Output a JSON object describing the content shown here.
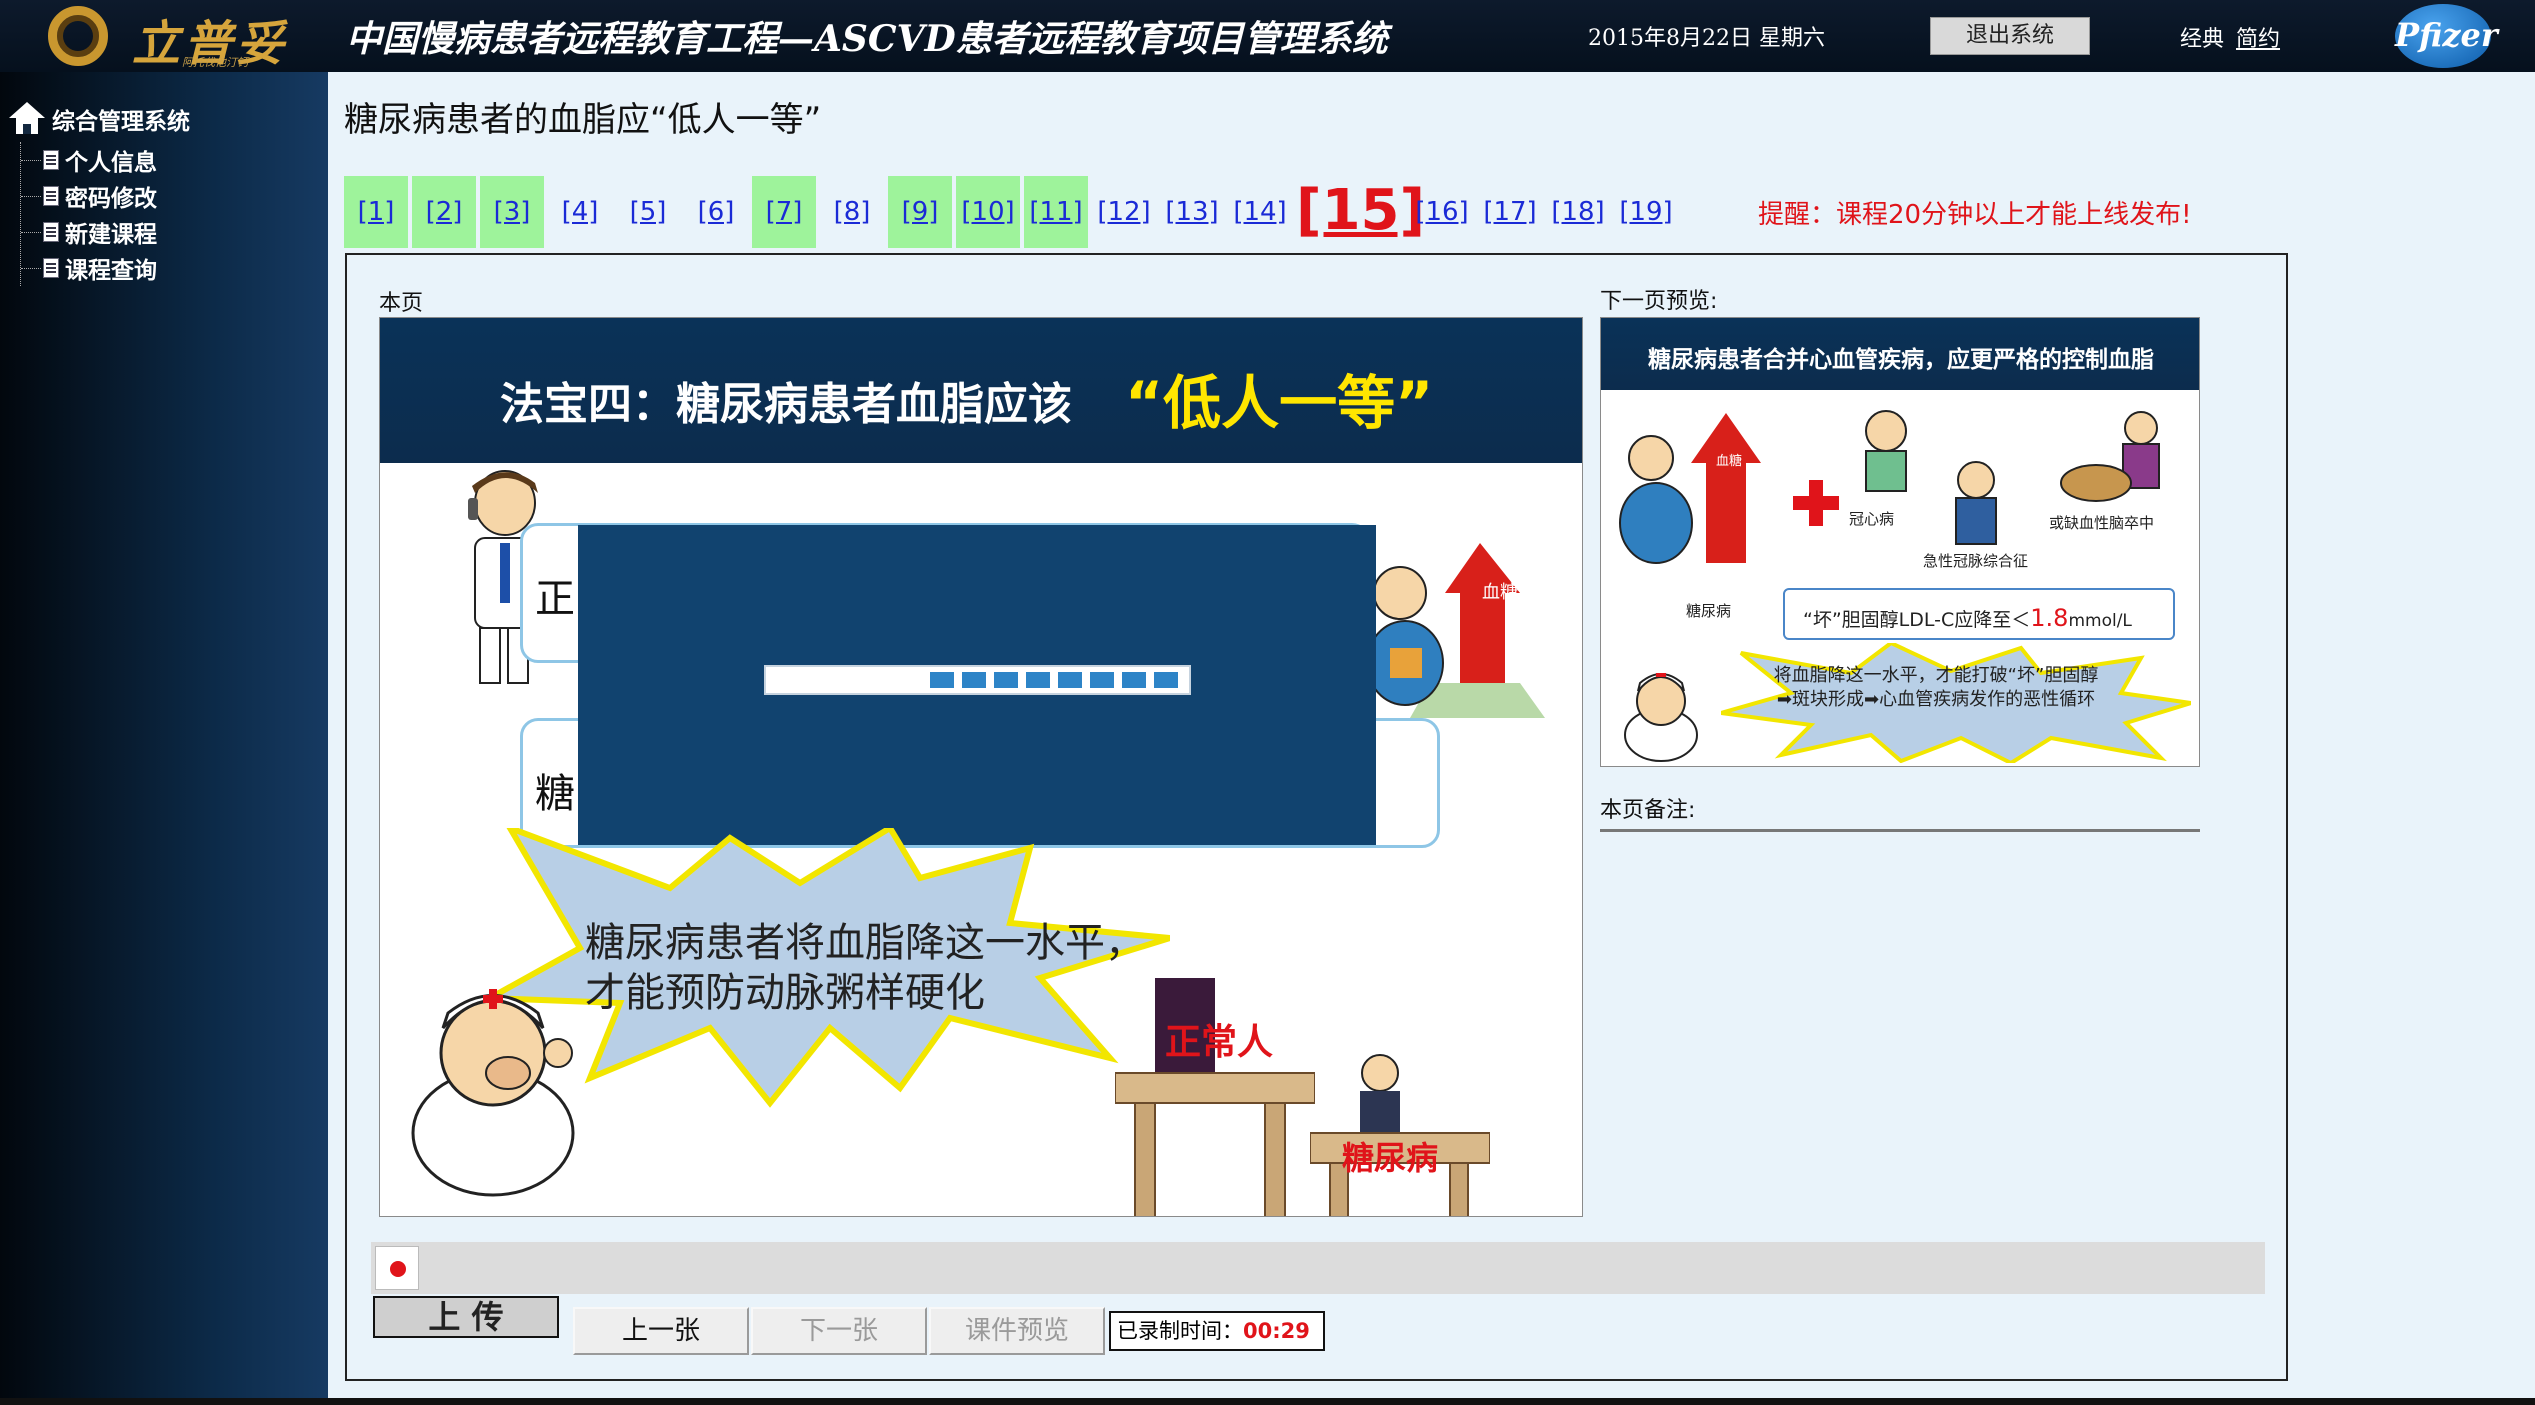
{
  "header": {
    "logo_text": "立普妥",
    "logo_tagline": "阿托伐他汀钙",
    "title": "中国慢病患者远程教育工程—ASCVD患者远程教育项目管理系统",
    "date": "2015年8月22日  星期六",
    "logout_label": "退出系统",
    "mode_classic": "经典",
    "mode_simple": "简约",
    "partner_logo": "Pfizer"
  },
  "sidebar": {
    "root_label": "综合管理系统",
    "items": [
      {
        "label": "个人信息"
      },
      {
        "label": "密码修改"
      },
      {
        "label": "新建课程"
      },
      {
        "label": "课程查询"
      }
    ]
  },
  "main": {
    "heading": "糖尿病患者的血脂应“低人一等”",
    "pager": {
      "pages": [
        "[1]",
        "[2]",
        "[3]",
        "[4]",
        "[5]",
        "[6]",
        "[7]",
        "[8]",
        "[9]",
        "[10]",
        "[11]",
        "[12]",
        "[13]",
        "[14]",
        "[15]",
        "[16]",
        "[17]",
        "[18]",
        "[19]"
      ],
      "completed": [
        1,
        2,
        3,
        7,
        9,
        10,
        11
      ],
      "current": 15
    },
    "reminder": "提醒：课程20分钟以上才能上线发布!"
  },
  "current_slide": {
    "label": "本页",
    "title": "法宝四：糖尿病患者血脂应该",
    "title_emphasis": "“低人一等”",
    "box1_text": "正",
    "box2_text": "糖",
    "burst_text": "糖尿病患者将血脂降这一水平，才能预防动脉粥样硬化",
    "podium_normal": "正常人",
    "podium_diabetes": "糖尿病",
    "side_figure_label": "血糖",
    "loading_progress": 0.6
  },
  "next_preview": {
    "label": "下一页预览:",
    "title": "糖尿病患者合并心血管疾病，应更严格的控制血脂",
    "arrow_label": "血糖",
    "labels": {
      "coronary": "冠心病",
      "acs": "急性冠脉综合征",
      "stroke": "或缺血性脑卒中",
      "diabetes": "糖尿病"
    },
    "ldl_prefix": "“坏”胆固醇LDL-C应降至＜",
    "ldl_value": "1.8",
    "ldl_unit": "mmol/L",
    "burst_text": "将血脂降这一水平，才能打破“坏”胆固醇➡斑块形成➡心血管疾病发作的恶性循环"
  },
  "notes": {
    "label": "本页备注:"
  },
  "controls": {
    "upload_label": "上 传",
    "prev_label": "上一张",
    "next_label": "下一张",
    "preview_label": "课件预览",
    "timer_label": "已录制时间：",
    "timer_value": "00:29"
  },
  "colors": {
    "header_bg": "#0d1a2c",
    "sidebar_bg": "#0c2a48",
    "completed_page": "#9ef39b",
    "link": "#1a2ad6",
    "alert": "#e0141a",
    "slide_header": "#0a3258",
    "emphasis": "#ffe600"
  }
}
